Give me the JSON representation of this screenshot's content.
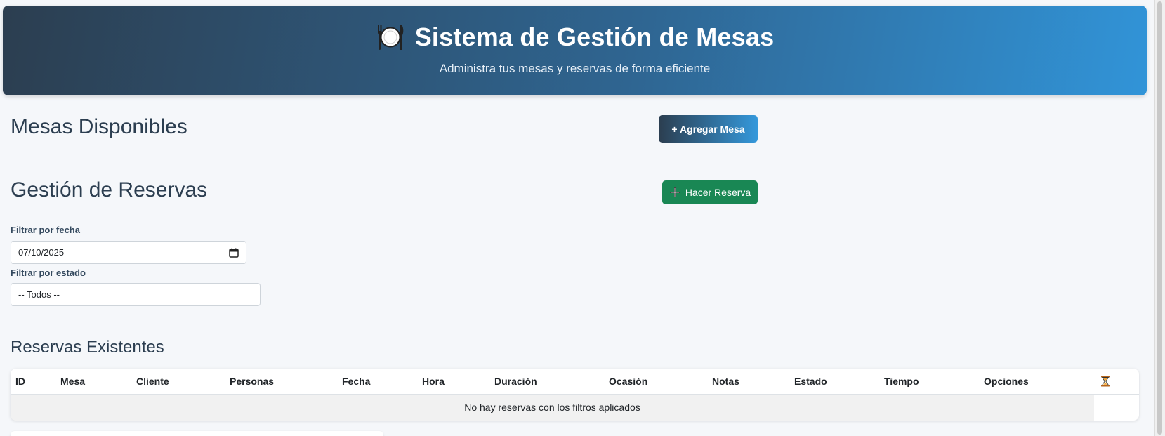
{
  "header": {
    "icon": "plate-cutlery-icon",
    "title": "Sistema de Gestión de Mesas",
    "subtitle": "Administra tus mesas y reservas de forma eficiente"
  },
  "tables_section": {
    "title": "Mesas Disponibles",
    "add_button_label": "+ Agregar Mesa"
  },
  "reservations_section": {
    "title": "Gestión de Reservas",
    "reserve_button_icon": "plus-icon",
    "reserve_button_label": "Hacer Reserva",
    "date_filter_label": "Filtrar por fecha",
    "date_filter_value": "07/10/2025",
    "status_filter_label": "Filtrar por estado",
    "status_filter_value": "-- Todos --"
  },
  "existing_reservations": {
    "title": "Reservas Existentes",
    "columns": [
      "ID",
      "Mesa",
      "Cliente",
      "Personas",
      "Fecha",
      "Hora",
      "Duración",
      "Ocasión",
      "Notas",
      "Estado",
      "Tiempo",
      "Opciones"
    ],
    "last_column_icon": "hourglass-icon",
    "empty_message": "No hay reservas con los filtros aplicados"
  },
  "colors": {
    "header_gradient_start": "#2c3e50",
    "header_gradient_end": "#3194d8",
    "reserve_button": "#198754",
    "page_background": "#f5f7fa"
  }
}
